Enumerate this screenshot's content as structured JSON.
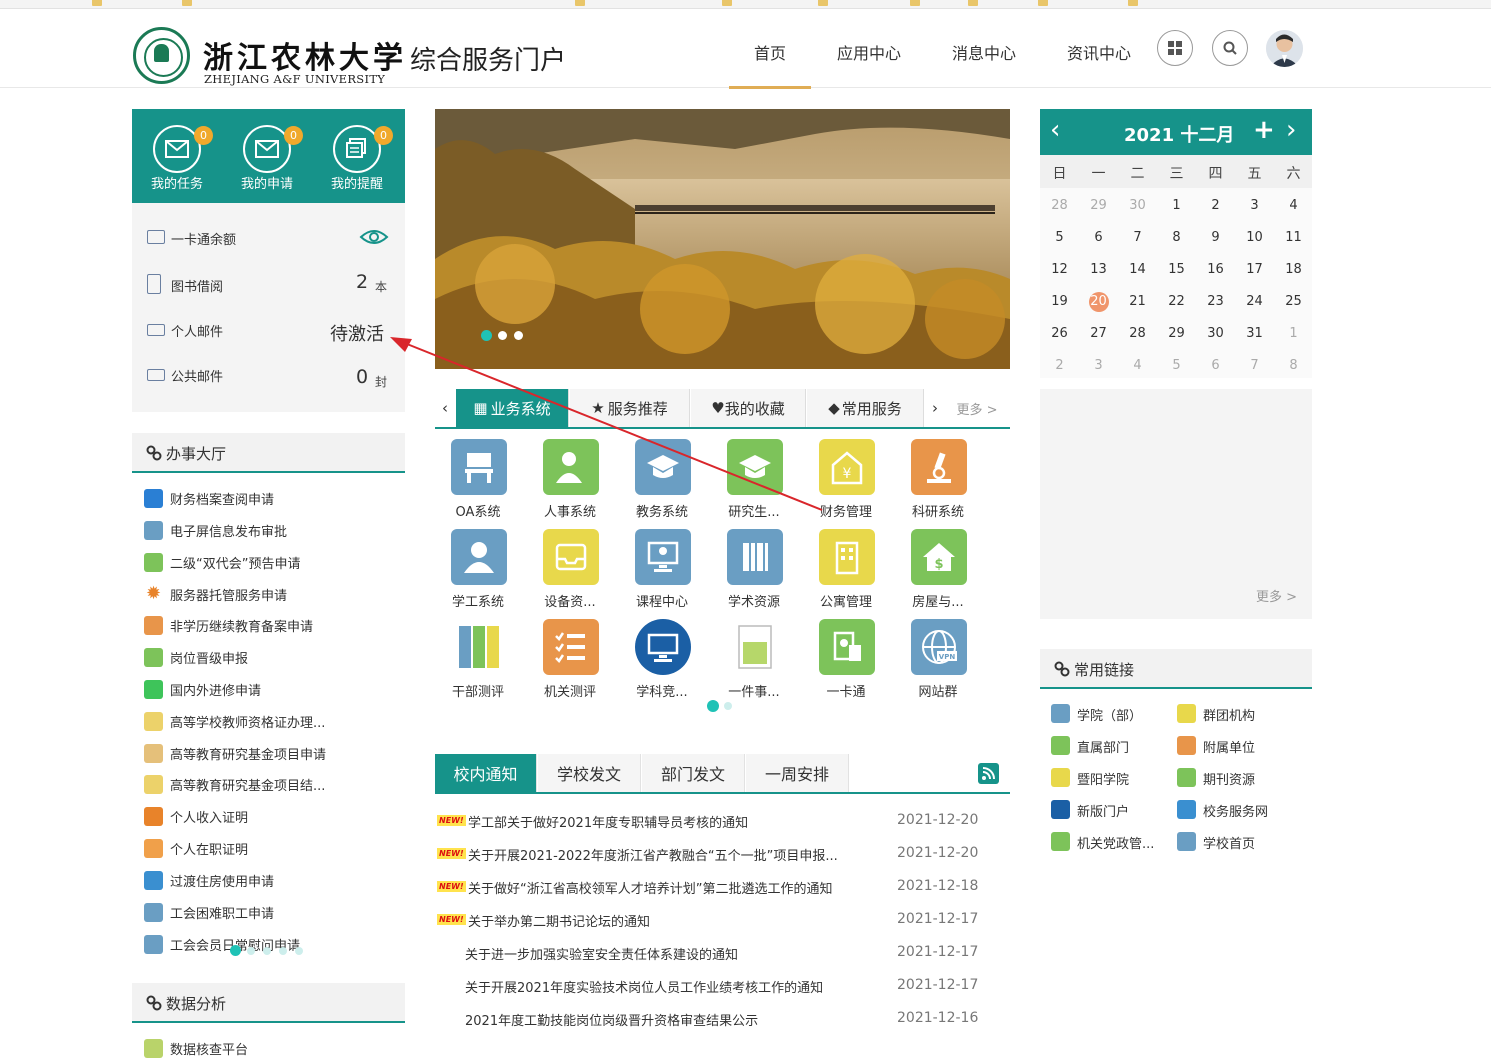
{
  "header": {
    "logo_cn": "浙江农林大学",
    "logo_en": "ZHEJIANG A&F UNIVERSITY",
    "portal_title": "综合服务门户",
    "nav": [
      "首页",
      "应用中心",
      "消息中心",
      "资讯中心"
    ]
  },
  "quick": [
    {
      "label": "我的任务",
      "count": "0"
    },
    {
      "label": "我的申请",
      "count": "0"
    },
    {
      "label": "我的提醒",
      "count": "0"
    }
  ],
  "info": {
    "card_label": "一卡通余额",
    "books_label": "图书借阅",
    "books_value": "2",
    "books_unit": "本",
    "mail_label": "个人邮件",
    "mail_value": "待激活",
    "public_mail_label": "公共邮件",
    "public_mail_value": "0",
    "public_mail_unit": "封"
  },
  "hall": {
    "title": "办事大厅",
    "items": [
      "财务档案查阅申请",
      "电子屏信息发布审批",
      "二级“双代会”预告申请",
      "服务器托管服务申请",
      "非学历继续教育备案申请",
      "岗位晋级申报",
      "国内外进修申请",
      "高等学校教师资格证办理...",
      "高等教育研究基金项目申请",
      "高等教育研究基金项目结...",
      "个人收入证明",
      "个人在职证明",
      "过渡住房使用申请",
      "工会困难职工申请",
      "工会会员日常慰问申请"
    ]
  },
  "analysis": {
    "title": "数据分析",
    "items": [
      "数据核查平台"
    ]
  },
  "service_tabs": {
    "tabs": [
      "业务系统",
      "服务推荐",
      "我的收藏",
      "常用服务"
    ],
    "more": "更多 >"
  },
  "apps": [
    {
      "label": "OA系统",
      "color": "#6a9ec3"
    },
    {
      "label": "人事系统",
      "color": "#7dc35a"
    },
    {
      "label": "教务系统",
      "color": "#6a9ec3"
    },
    {
      "label": "研究生...",
      "color": "#7dc35a"
    },
    {
      "label": "财务管理",
      "color": "#e8d84b"
    },
    {
      "label": "科研系统",
      "color": "#e8954a"
    },
    {
      "label": "学工系统",
      "color": "#6a9ec3"
    },
    {
      "label": "设备资...",
      "color": "#e8d84b"
    },
    {
      "label": "课程中心",
      "color": "#6a9ec3"
    },
    {
      "label": "学术资源",
      "color": "#6a9ec3"
    },
    {
      "label": "公寓管理",
      "color": "#e8d84b"
    },
    {
      "label": "房屋与...",
      "color": "#7dc35a"
    },
    {
      "label": "干部测评",
      "color": "#b6c9d6"
    },
    {
      "label": "机关测评",
      "color": "#e8954a"
    },
    {
      "label": "学科竞...",
      "color": "#1b5fa5"
    },
    {
      "label": "一件事...",
      "color": "#eeeeee"
    },
    {
      "label": "一卡通",
      "color": "#7dc35a"
    },
    {
      "label": "网站群",
      "color": "#6a9ec3"
    }
  ],
  "notices": {
    "tabs": [
      "校内通知",
      "学校发文",
      "部门发文",
      "一周安排"
    ],
    "items": [
      {
        "title": "学工部关于做好2021年度专职辅导员考核的通知",
        "date": "2021-12-20",
        "new": true
      },
      {
        "title": "关于开展2021-2022年度浙江省产教融合“五个一批”项目申报...",
        "date": "2021-12-20",
        "new": true
      },
      {
        "title": "关于做好“浙江省高校领军人才培养计划”第二批遴选工作的通知",
        "date": "2021-12-18",
        "new": true
      },
      {
        "title": "关于举办第二期书记论坛的通知",
        "date": "2021-12-17",
        "new": true
      },
      {
        "title": "关于进一步加强实验室安全责任体系建设的通知",
        "date": "2021-12-17",
        "new": false
      },
      {
        "title": "关于开展2021年度实验技术岗位人员工作业绩考核工作的通知",
        "date": "2021-12-17",
        "new": false
      },
      {
        "title": "2021年度工勤技能岗位岗级晋升资格审查结果公示",
        "date": "2021-12-16",
        "new": false
      }
    ],
    "new_badge": "NEW!"
  },
  "calendar": {
    "title": "2021 十二月",
    "weekdays": [
      "日",
      "一",
      "二",
      "三",
      "四",
      "五",
      "六"
    ],
    "weeks": [
      [
        "28",
        "29",
        "30",
        "1",
        "2",
        "3",
        "4"
      ],
      [
        "5",
        "6",
        "7",
        "8",
        "9",
        "10",
        "11"
      ],
      [
        "12",
        "13",
        "14",
        "15",
        "16",
        "17",
        "18"
      ],
      [
        "19",
        "20",
        "21",
        "22",
        "23",
        "24",
        "25"
      ],
      [
        "26",
        "27",
        "28",
        "29",
        "30",
        "31",
        "1"
      ],
      [
        "2",
        "3",
        "4",
        "5",
        "6",
        "7",
        "8"
      ]
    ],
    "today": "20",
    "more": "更多 >"
  },
  "links": {
    "title": "常用链接",
    "items": [
      {
        "label": "学院（部）",
        "color": "#6a9ec3"
      },
      {
        "label": "群团机构",
        "color": "#e8d84b"
      },
      {
        "label": "直属部门",
        "color": "#7dc35a"
      },
      {
        "label": "附属单位",
        "color": "#e8954a"
      },
      {
        "label": "暨阳学院",
        "color": "#e8d84b"
      },
      {
        "label": "期刊资源",
        "color": "#7dc35a"
      },
      {
        "label": "新版门户",
        "color": "#1b5fa5"
      },
      {
        "label": "校务服务网",
        "color": "#3a8fd0"
      },
      {
        "label": "机关党政管...",
        "color": "#7dc35a"
      },
      {
        "label": "学校首页",
        "color": "#6a9ec3"
      }
    ]
  },
  "colors": {
    "accent": "#16938a",
    "nav_active": "#e0ad55",
    "badge": "#f0a92c",
    "annotation": "#d9262b",
    "today": "#f0956b"
  }
}
